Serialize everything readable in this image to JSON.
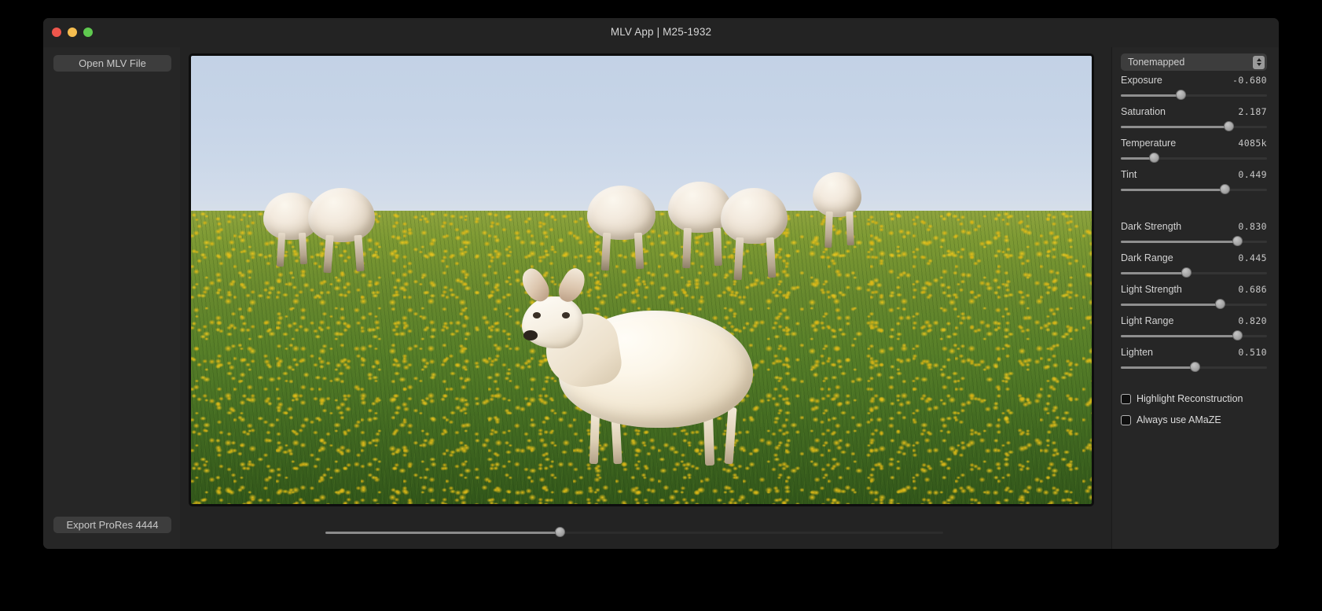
{
  "window": {
    "title": "MLV App | M25-1932",
    "traffic_lights": {
      "close": "close",
      "minimize": "minimize",
      "maximize": "maximize"
    }
  },
  "sidebar": {
    "open_button": "Open MLV File",
    "export_button": "Export ProRes 4444"
  },
  "viewer": {
    "timeline_position_pct": 38
  },
  "right_panel": {
    "profile": {
      "selected": "Tonemapped",
      "stepper_icon": "stepper-chevrons-icon"
    },
    "controls": [
      {
        "label": "Exposure",
        "value": "-0.680",
        "pos_pct": 41
      },
      {
        "label": "Saturation",
        "value": "2.187",
        "pos_pct": 74
      },
      {
        "label": "Temperature",
        "value": "4085k",
        "pos_pct": 23
      },
      {
        "label": "Tint",
        "value": "0.449",
        "pos_pct": 71
      },
      {
        "label": "Dark Strength",
        "value": "0.830",
        "pos_pct": 80
      },
      {
        "label": "Dark Range",
        "value": "0.445",
        "pos_pct": 45
      },
      {
        "label": "Light Strength",
        "value": "0.686",
        "pos_pct": 68
      },
      {
        "label": "Light Range",
        "value": "0.820",
        "pos_pct": 80
      },
      {
        "label": "Lighten",
        "value": "0.510",
        "pos_pct": 51
      }
    ],
    "checkboxes": [
      {
        "label": "Highlight Reconstruction",
        "checked": false
      },
      {
        "label": "Always use AMaZE",
        "checked": false
      }
    ]
  }
}
